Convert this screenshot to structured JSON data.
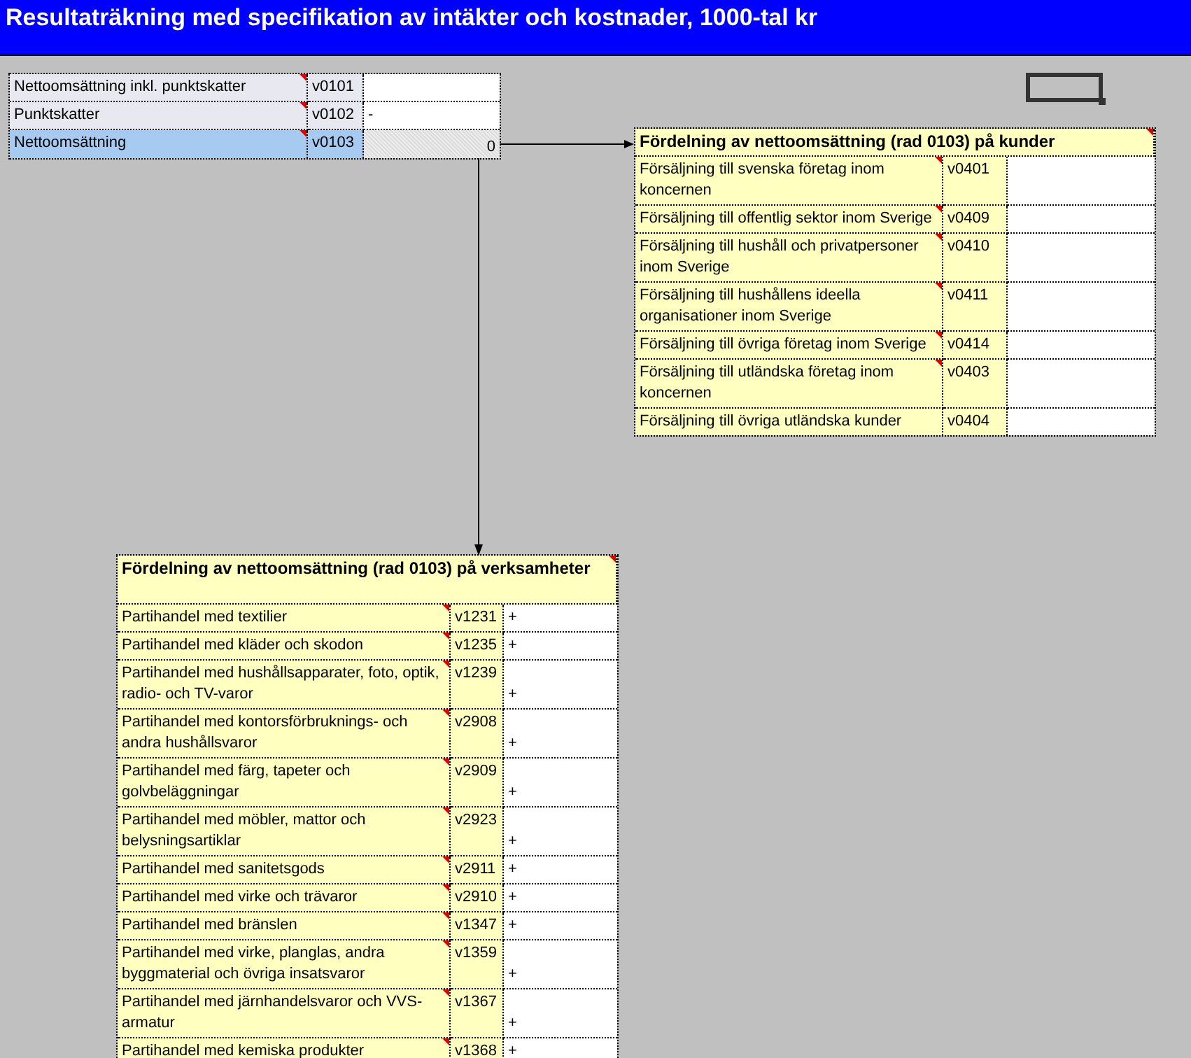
{
  "title": "Resultaträkning med specifikation av intäkter och kostnader, 1000-tal kr",
  "summary_rows": [
    {
      "label": "Nettoomsättning inkl. punktskatter",
      "code": "v0101",
      "value": "",
      "has_comment": true,
      "selected": false,
      "computed": false
    },
    {
      "label": "Punktskatter",
      "code": "v0102",
      "value": "-",
      "has_comment": true,
      "selected": false,
      "computed": false
    },
    {
      "label": "Nettoomsättning",
      "code": "v0103",
      "value": "0",
      "has_comment": true,
      "selected": true,
      "computed": true
    }
  ],
  "customers": {
    "heading": "Fördelning av nettoomsättning (rad 0103) på kunder",
    "has_comment": true,
    "rows": [
      {
        "label": "Försäljning till svenska företag inom koncernen",
        "code": "v0401",
        "value": "",
        "has_comment": true
      },
      {
        "label": "Försäljning till offentlig sektor inom Sverige",
        "code": "v0409",
        "value": "",
        "has_comment": true
      },
      {
        "label": "Försäljning till hushåll och privatpersoner inom Sverige",
        "code": "v0410",
        "value": "",
        "has_comment": true
      },
      {
        "label": "Försäljning till hushållens ideella organisationer inom Sverige",
        "code": "v0411",
        "value": "",
        "has_comment": true
      },
      {
        "label": "Försäljning till övriga företag inom Sverige",
        "code": "v0414",
        "value": "",
        "has_comment": true
      },
      {
        "label": "Försäljning till utländska företag inom koncernen",
        "code": "v0403",
        "value": "",
        "has_comment": true
      },
      {
        "label": "Försäljning till övriga utländska kunder",
        "code": "v0404",
        "value": "",
        "has_comment": false
      }
    ]
  },
  "activities": {
    "heading": "Fördelning av nettoomsättning (rad 0103) på verksamheter",
    "has_comment": true,
    "rows": [
      {
        "label": "Partihandel med textilier",
        "code": "v1231",
        "value": "+",
        "has_comment": true
      },
      {
        "label": "Partihandel med kläder och skodon",
        "code": "v1235",
        "value": "+",
        "has_comment": true
      },
      {
        "label": "Partihandel med hushållsapparater, foto, optik, radio- och TV-varor",
        "code": "v1239",
        "value": "+",
        "has_comment": true
      },
      {
        "label": "Partihandel med kontorsförbruknings- och andra hushållsvaror",
        "code": "v2908",
        "value": "+",
        "has_comment": true
      },
      {
        "label": "Partihandel med färg, tapeter och golvbeläggningar",
        "code": "v2909",
        "value": "+",
        "has_comment": true
      },
      {
        "label": "Partihandel med möbler, mattor och belysningsartiklar",
        "code": "v2923",
        "value": "+",
        "has_comment": true
      },
      {
        "label": "Partihandel med sanitetsgods",
        "code": "v2911",
        "value": "+",
        "has_comment": true
      },
      {
        "label": "Partihandel med virke och trävaror",
        "code": "v2910",
        "value": "+",
        "has_comment": true
      },
      {
        "label": "Partihandel med bränslen",
        "code": "v1347",
        "value": "+",
        "has_comment": true
      },
      {
        "label": "Partihandel med virke, planglas, andra byggmaterial och övriga insatsvaror",
        "code": "v1359",
        "value": "+",
        "has_comment": true
      },
      {
        "label": "Partihandel med järnhandelsvaror och VVS-armatur",
        "code": "v1367",
        "value": "+",
        "has_comment": true
      },
      {
        "label": "Partihandel med kemiska produkter",
        "code": "v1368",
        "value": "+",
        "has_comment": true
      }
    ]
  }
}
